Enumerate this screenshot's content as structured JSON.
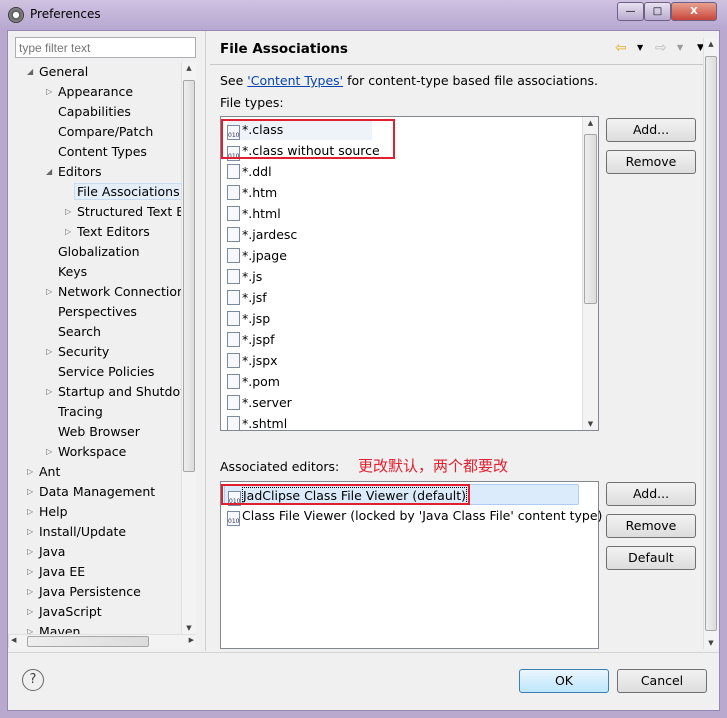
{
  "window": {
    "title": "Preferences",
    "minimize": "—",
    "maximize": "□",
    "close": "X",
    "accent_close": "#c7463a"
  },
  "filter": {
    "placeholder": "type filter text"
  },
  "tree": [
    {
      "label": "General",
      "level": 0,
      "expanded": true
    },
    {
      "label": "Appearance",
      "level": 1,
      "collapsed": true
    },
    {
      "label": "Capabilities",
      "level": 1
    },
    {
      "label": "Compare/Patch",
      "level": 1
    },
    {
      "label": "Content Types",
      "level": 1
    },
    {
      "label": "Editors",
      "level": 1,
      "expanded": true
    },
    {
      "label": "File Associations",
      "level": 2,
      "selected": true
    },
    {
      "label": "Structured Text Ed",
      "level": 2,
      "collapsed": true
    },
    {
      "label": "Text Editors",
      "level": 2,
      "collapsed": true
    },
    {
      "label": "Globalization",
      "level": 1
    },
    {
      "label": "Keys",
      "level": 1
    },
    {
      "label": "Network Connection",
      "level": 1,
      "collapsed": true
    },
    {
      "label": "Perspectives",
      "level": 1
    },
    {
      "label": "Search",
      "level": 1
    },
    {
      "label": "Security",
      "level": 1,
      "collapsed": true
    },
    {
      "label": "Service Policies",
      "level": 1
    },
    {
      "label": "Startup and Shutdow",
      "level": 1,
      "collapsed": true
    },
    {
      "label": "Tracing",
      "level": 1
    },
    {
      "label": "Web Browser",
      "level": 1
    },
    {
      "label": "Workspace",
      "level": 1,
      "collapsed": true
    },
    {
      "label": "Ant",
      "level": 0,
      "collapsed": true
    },
    {
      "label": "Data Management",
      "level": 0,
      "collapsed": true
    },
    {
      "label": "Help",
      "level": 0,
      "collapsed": true
    },
    {
      "label": "Install/Update",
      "level": 0,
      "collapsed": true
    },
    {
      "label": "Java",
      "level": 0,
      "collapsed": true
    },
    {
      "label": "Java EE",
      "level": 0,
      "collapsed": true
    },
    {
      "label": "Java Persistence",
      "level": 0,
      "collapsed": true
    },
    {
      "label": "JavaScript",
      "level": 0,
      "collapsed": true
    },
    {
      "label": "Maven",
      "level": 0,
      "collapsed": true
    }
  ],
  "page": {
    "title": "File Associations",
    "see_prefix": "See ",
    "content_types_link": "'Content Types'",
    "see_suffix": " for content-type based file associations.",
    "file_types_label": "File types:",
    "file_types": [
      "*.class",
      "*.class without source",
      "*.ddl",
      "*.htm",
      "*.html",
      "*.jardesc",
      "*.jpage",
      "*.js",
      "*.jsf",
      "*.jsp",
      "*.jspf",
      "*.jspx",
      "*.pom",
      "*.server",
      "*.shtml"
    ],
    "file_type_icons": [
      "class-file-icon",
      "class-file-icon",
      "ddl-file-icon",
      "html-file-icon",
      "html-file-icon",
      "jar-file-icon",
      "java-file-icon",
      "js-file-icon",
      "file-icon",
      "file-icon",
      "file-icon",
      "file-icon",
      "maven-file-icon",
      "server-file-icon",
      "web-file-icon"
    ],
    "add_label": "Add...",
    "remove_label": "Remove",
    "default_label": "Default",
    "associated_label": "Associated editors:",
    "annotation": "更改默认，两个都要改",
    "annotation_color": "#e02030",
    "editors": [
      "JadClipse Class File Viewer (default)",
      "Class File Viewer (locked by 'Java Class File' content type)"
    ]
  },
  "footer": {
    "help": "?",
    "ok": "OK",
    "cancel": "Cancel"
  }
}
